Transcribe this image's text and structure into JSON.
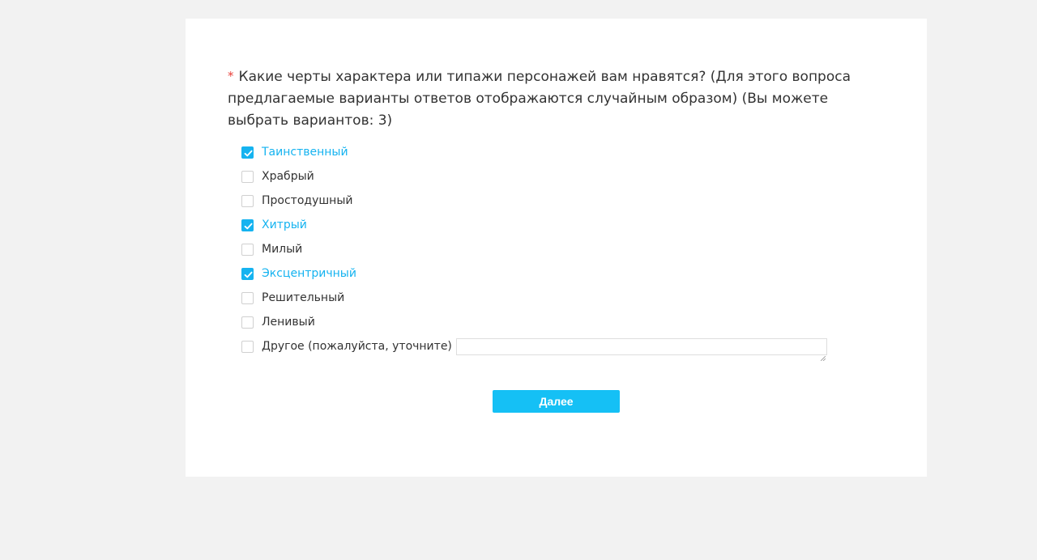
{
  "question": {
    "required_mark": "*",
    "text": "Какие черты характера или типажи персонажей вам нравятся? (Для этого вопроса предлагаемые варианты ответов отображаются случайным образом)",
    "hint": "(Вы можете выбрать вариантов: 3)"
  },
  "options": [
    {
      "label": "Таинственный",
      "checked": true
    },
    {
      "label": "Храбрый",
      "checked": false
    },
    {
      "label": "Простодушный",
      "checked": false
    },
    {
      "label": "Хитрый",
      "checked": true
    },
    {
      "label": "Милый",
      "checked": false
    },
    {
      "label": "Эксцентричный",
      "checked": true
    },
    {
      "label": "Решительный",
      "checked": false
    },
    {
      "label": "Ленивый",
      "checked": false
    },
    {
      "label": "Другое (пожалуйста, уточните)",
      "checked": false,
      "has_input": true,
      "input_value": ""
    }
  ],
  "next_button": {
    "label": "Далее"
  },
  "colors": {
    "accent": "#15b3f0",
    "button": "#15c0f5",
    "required": "#e8403a",
    "background": "#f2f2f2"
  }
}
